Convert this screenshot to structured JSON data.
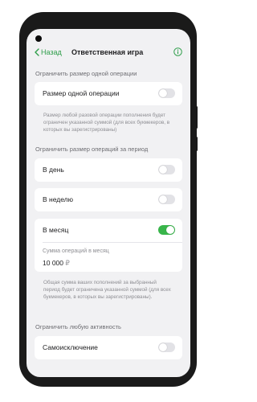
{
  "header": {
    "back_label": "Назад",
    "title": "Ответственная игра"
  },
  "sections": {
    "single": {
      "label": "Ограничить размер одной операции",
      "row_label": "Размер одной операции",
      "toggle_on": false,
      "note": "Размер любой разовой операции пополнения будет ограничен указанной суммой (для всех букмекеров, в которых вы зарегистрированы)"
    },
    "period": {
      "label": "Ограничить размер операций за период",
      "day_label": "В день",
      "day_on": false,
      "week_label": "В неделю",
      "week_on": false,
      "month_label": "В месяц",
      "month_on": true,
      "amount_label": "Сумма операций в месяц",
      "amount_value": "10 000",
      "currency": "₽",
      "note": "Общая сумма ваших пополнений за выбранный период будет ограничена указанной суммой (для всех букмекеров, в которых вы зарегистрированы)."
    },
    "activity": {
      "label": "Ограничить любую активность",
      "row_label": "Самоисключение",
      "toggle_on": false
    }
  },
  "icons": {
    "back": "chevron-left-icon",
    "info": "info-icon"
  },
  "colors": {
    "accent": "#2f9e4a",
    "toggle_on": "#38b54a",
    "toggle_off": "#e2e2e6",
    "background": "#f1f1f3"
  }
}
